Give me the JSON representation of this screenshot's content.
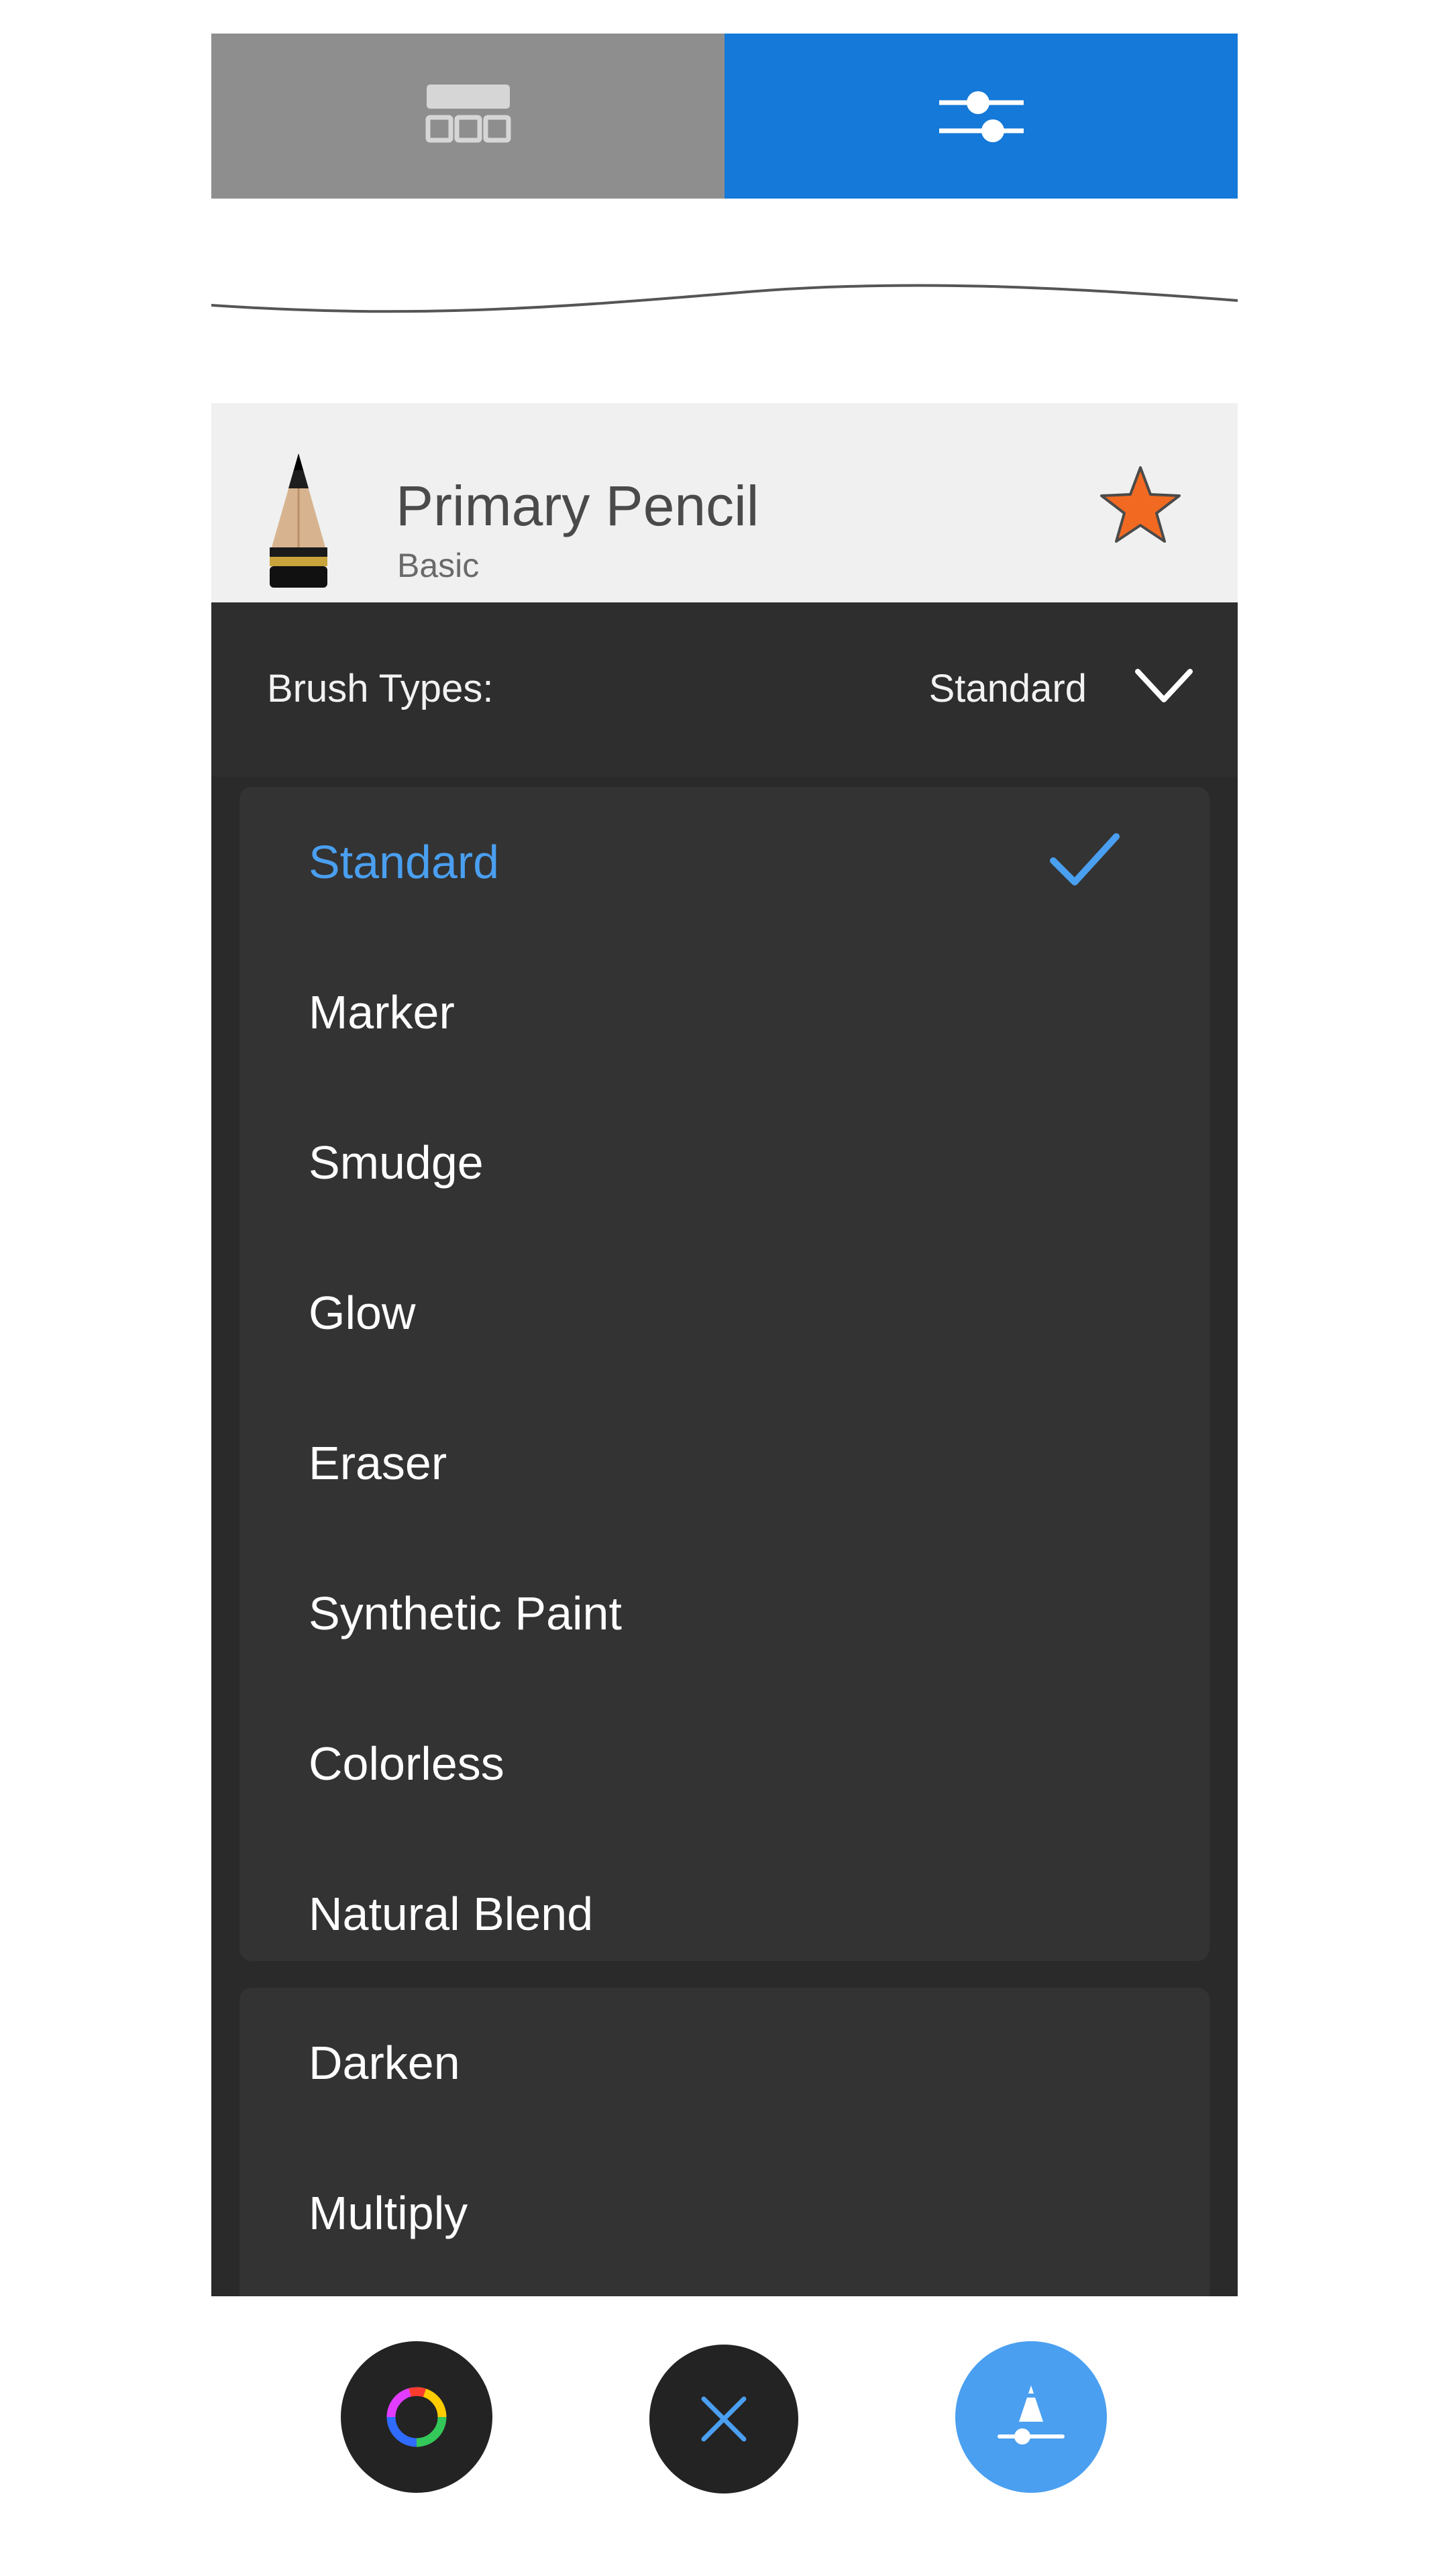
{
  "tabs": [
    {
      "icon": "brush-library-icon",
      "active": false
    },
    {
      "icon": "sliders-icon",
      "active": true
    }
  ],
  "colors": {
    "tab_active": "#1479d8",
    "tab_inactive": "#8e8e8e",
    "accent": "#4a9ff0",
    "star": "#f26a21",
    "panel": "#2a2a2a"
  },
  "brush": {
    "name": "Primary Pencil",
    "category": "Basic",
    "icon": "pencil-icon",
    "favorite_icon": "star-icon"
  },
  "brush_types": {
    "label": "Brush Types:",
    "selected": "Standard",
    "options_group1": [
      "Standard",
      "Marker",
      "Smudge",
      "Glow",
      "Eraser",
      "Synthetic Paint",
      "Colorless",
      "Natural Blend"
    ],
    "options_group2": [
      "Darken",
      "Multiply"
    ]
  },
  "bottom_bar": {
    "buttons": [
      "color-wheel-icon",
      "close-icon",
      "brush-properties-icon"
    ]
  }
}
